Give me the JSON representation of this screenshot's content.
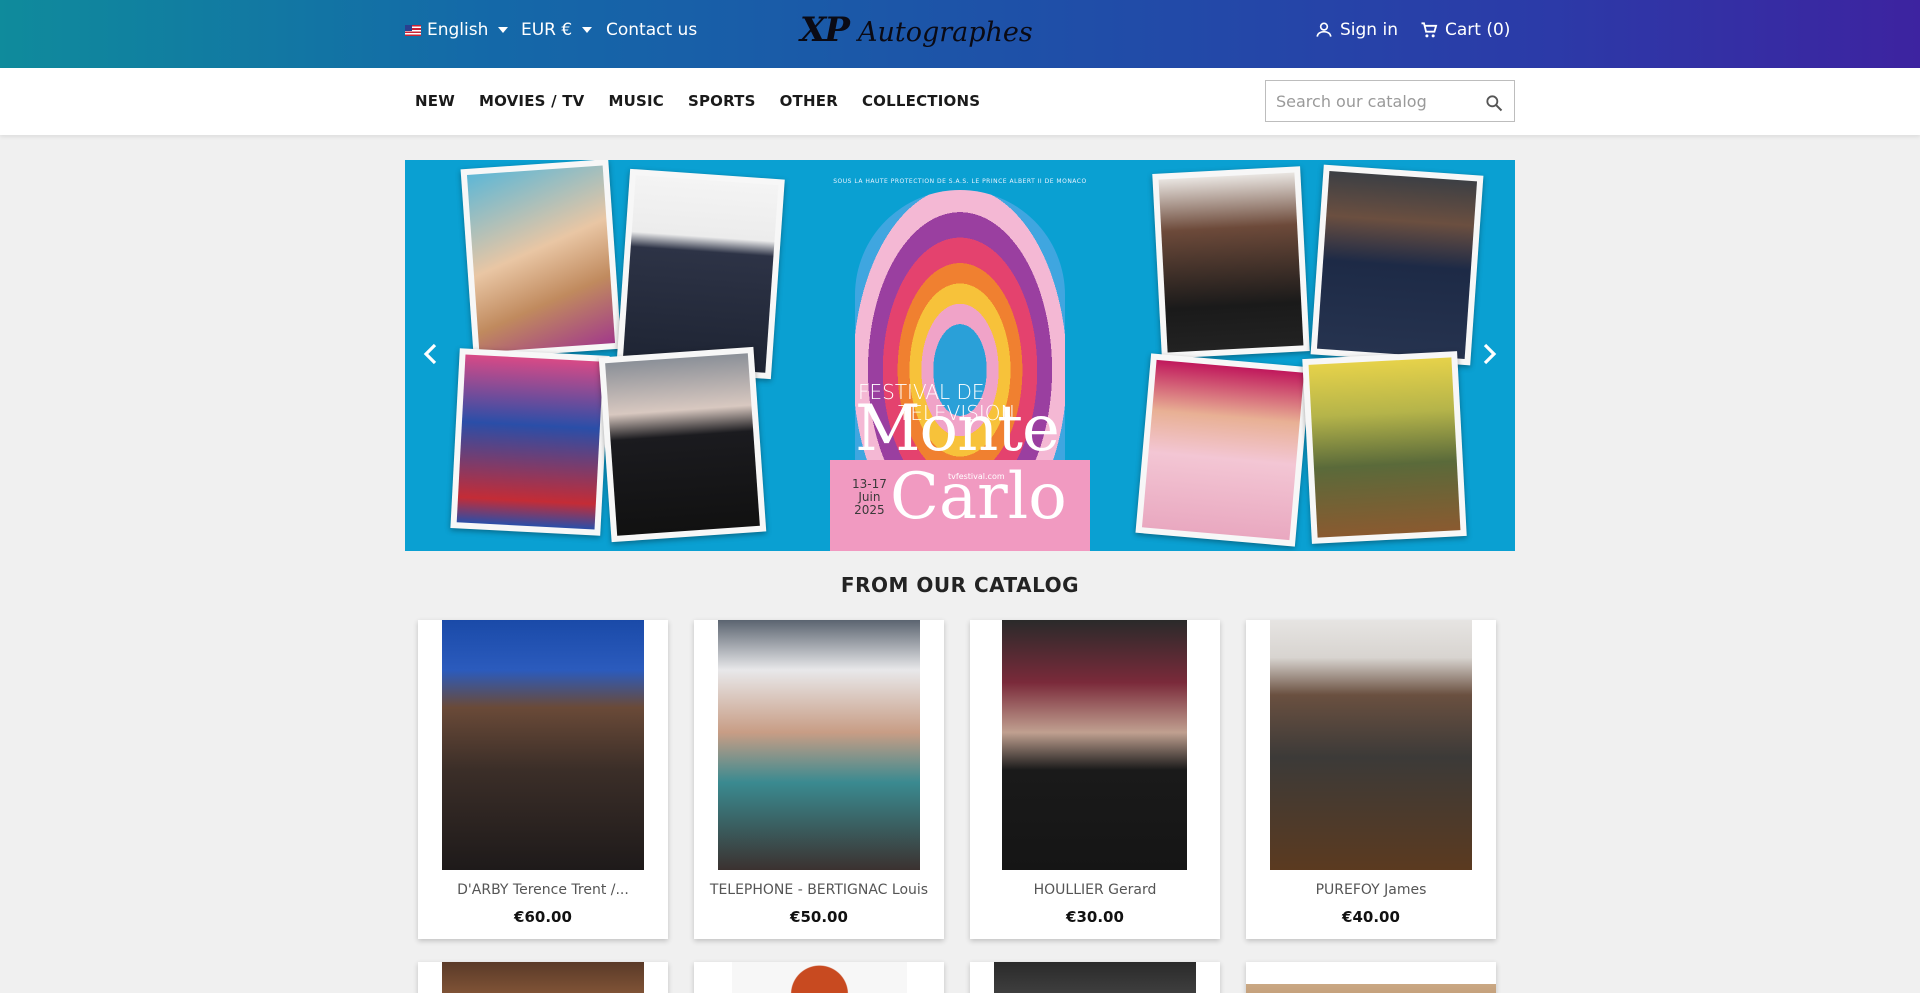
{
  "header": {
    "language": "English",
    "currency": "EUR €",
    "contact": "Contact us",
    "logo_mark": "XP",
    "logo_text": "Autographes",
    "sign_in": "Sign in",
    "cart": "Cart (0)"
  },
  "nav": {
    "items": [
      "NEW",
      "MOVIES / TV",
      "MUSIC",
      "SPORTS",
      "OTHER",
      "COLLECTIONS"
    ],
    "search_placeholder": "Search our catalog"
  },
  "banner": {
    "poster_top_text": "SOUS LA HAUTE PROTECTION DE S.A.S. LE PRINCE ALBERT II DE MONACO",
    "festival_line1": "FESTIVAL DE",
    "festival_line2": "TELEVISION",
    "city_line1": "Monte",
    "city_line2": "Carlo",
    "dates_line1": "13-17",
    "dates_line2": "Juin",
    "dates_line3": "2025",
    "website": "tvfestival.com"
  },
  "catalog": {
    "title": "FROM OUR CATALOG",
    "products": [
      {
        "name": "D'ARBY Terence Trent /...",
        "price": "€60.00"
      },
      {
        "name": "TELEPHONE - BERTIGNAC Louis",
        "price": "€50.00"
      },
      {
        "name": "HOULLIER Gerard",
        "price": "€30.00"
      },
      {
        "name": "PUREFOY James",
        "price": "€40.00"
      }
    ]
  },
  "colors": {
    "topbar_start": "#0f8b9c",
    "topbar_end": "#3d23a0",
    "banner_bg": "#0aa0d2",
    "page_bg": "#f0f0f0"
  },
  "icons": [
    "flag-us-icon",
    "caret-down-icon",
    "user-icon",
    "cart-icon",
    "search-icon",
    "chevron-left-icon",
    "chevron-right-icon"
  ]
}
